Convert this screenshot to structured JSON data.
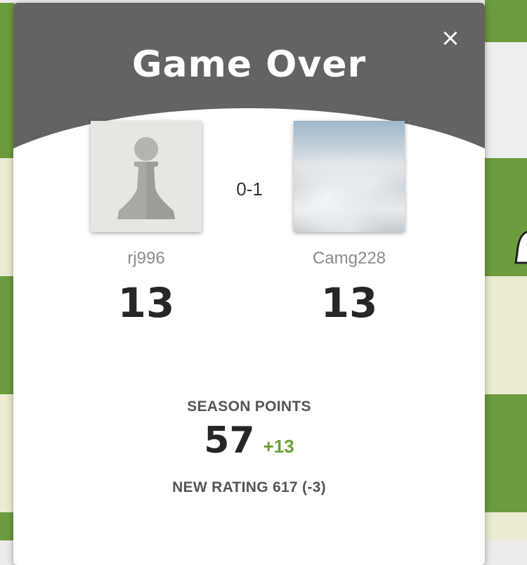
{
  "modal": {
    "title": "Game Over",
    "close_icon": "close-icon",
    "close_symbol": "×"
  },
  "players": {
    "left": {
      "username": "rj996",
      "rating": "13",
      "avatar": "pawn-icon"
    },
    "right": {
      "username": "Camg228",
      "rating": "13",
      "avatar": "clouds-photo"
    }
  },
  "result": "0-1",
  "season": {
    "label": "SEASON POINTS",
    "points": "57",
    "delta": "+13"
  },
  "new_rating": "NEW RATING 617 (-3)",
  "colors": {
    "header": "#646362",
    "board_dark": "#6c9c3e",
    "board_light": "#ececd2",
    "positive": "#6aa035"
  }
}
